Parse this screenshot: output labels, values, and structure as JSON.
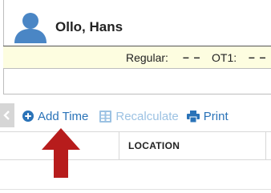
{
  "employee": {
    "name": "Ollo, Hans"
  },
  "hours": {
    "regular_label": "Regular:",
    "regular_value": "– –",
    "ot1_label": "OT1:",
    "ot1_value": "– –"
  },
  "toolbar": {
    "add_time_label": "Add Time",
    "recalculate_label": "Recalculate",
    "print_label": "Print"
  },
  "table": {
    "columns": [
      "",
      "LOCATION",
      ""
    ]
  },
  "colors": {
    "accent": "#2a73b8",
    "disabled": "#9cc2e3",
    "avatar": "#4a86c5",
    "hours_bg": "#fdfde0",
    "annotation_arrow": "#b71c1c"
  }
}
